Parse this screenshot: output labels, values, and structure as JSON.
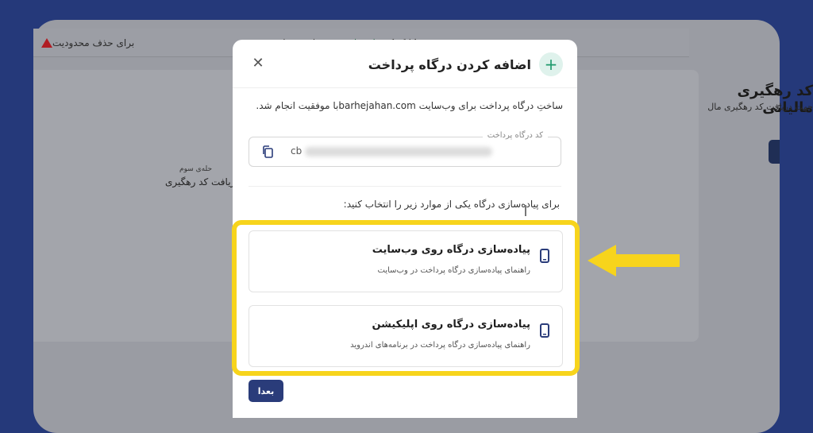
{
  "background": {
    "alert": {
      "prefix": "برای حذف محدودیت",
      "link": "این‌جا",
      "suffix": "کلیک کنید",
      "middle": "ود به سطح نقره‌ای ."
    },
    "title": "کد رهگیری مالیاتی",
    "subtitle": "جهت دریافت کد رهگیری مال",
    "step_small": "حله‌ی سوم",
    "step": "ریافت کد رهگیری"
  },
  "modal": {
    "title": "اضافه کردن درگاه پرداخت",
    "close_symbol": "✕",
    "plus_symbol": "+",
    "success_message": "ساختِ درگاه پرداخت برای وب‌سایت barhejahan.comبا موفقیت انجام شد.",
    "code_field": {
      "label": "کد درگاه پرداخت",
      "value_prefix": "cb"
    },
    "choose_label": "برای پیاده‌سازی درگاه یکی از موارد زیر را انتخاب کنید:",
    "options": [
      {
        "title": "پیاده‌سازی درگاه روی وب‌سایت",
        "description": "راهنمای پیاده‌سازی درگاه پرداخت در وب‌سایت"
      },
      {
        "title": "پیاده‌سازی درگاه روی اپلیکیشن",
        "description": "راهنمای پیاده‌سازی درگاه پرداخت در برنامه‌های اندروید"
      }
    ],
    "next_label": "بعدا"
  },
  "colors": {
    "accent": "#2a3c7a",
    "highlight": "#f7d41c",
    "plus_green": "#1f9a6d",
    "warning_red": "#b01d24"
  }
}
